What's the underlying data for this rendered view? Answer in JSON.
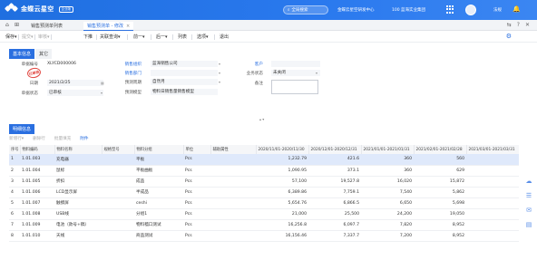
{
  "app": {
    "logo_text": "金蝶云星空",
    "logo_badge": "企业版",
    "search_label": "全局搜索",
    "org": "100 蓝海实业集团",
    "center": "金蝶云星空研发中心",
    "user": "法规"
  },
  "tabbar": {
    "tabs": [
      {
        "label": "销售预测单列表"
      },
      {
        "label": "销售预测单 - 修改"
      }
    ],
    "close_glyph": "×"
  },
  "toolbar": {
    "items": [
      {
        "label": "保存",
        "caret": "▾",
        "enabled": true
      },
      {
        "label": "提交",
        "caret": "▾",
        "enabled": false
      },
      {
        "label": "审核",
        "caret": "▾",
        "enabled": false
      },
      {
        "label": "下推",
        "caret": "",
        "enabled": true
      },
      {
        "label": "关联查询",
        "caret": "▾",
        "enabled": true
      },
      {
        "label": "前一",
        "caret": "▾",
        "enabled": true
      },
      {
        "label": "后一",
        "caret": "▾",
        "enabled": true
      },
      {
        "label": "列表",
        "caret": "",
        "enabled": true
      },
      {
        "label": "选项",
        "caret": "▾",
        "enabled": true
      },
      {
        "label": "退出",
        "caret": "",
        "enabled": true
      }
    ]
  },
  "section_tabs": [
    "基本信息",
    "其它"
  ],
  "form": {
    "bill_no_label": "单据编号",
    "bill_no": "XLYCD000006",
    "date_label": "日期",
    "date": "2021/2/25",
    "doc_status_label": "单据状态",
    "doc_status": "已审核",
    "stamp": "已审核",
    "sales_org_label": "销售组织",
    "sales_org": "蓝海销售公司",
    "sales_dept_label": "销售部门",
    "forecast_type_label": "预测周期",
    "forecast_type": "自然月",
    "forecast_model_label": "预测模型",
    "forecast_model": "物料日销售量销售模型",
    "customer_label": "客户",
    "biz_status_label": "业务状态",
    "biz_status": "未关闭",
    "memo_label": "备注"
  },
  "detail": {
    "tab": "明细信息",
    "toolbar": [
      {
        "label": "新增行",
        "caret": "▾",
        "active": false
      },
      {
        "label": "删除行",
        "caret": "",
        "active": false
      },
      {
        "label": "批量填充",
        "caret": "",
        "active": false
      },
      {
        "label": "附件",
        "caret": "",
        "active": true
      }
    ],
    "columns": [
      "序号",
      "物料编码",
      "物料名称",
      "规格型号",
      "物料分组",
      "单位",
      "辅助属性",
      "2020/11/01-2020/11/30",
      "2020/12/01-2020/12/31",
      "2021/01/01-2021/01/31",
      "2021/02/01-2021/02/28",
      "2021/03/01-2021/03/31"
    ],
    "rows": [
      {
        "seq": "1",
        "code": "1.01.003",
        "name": "充电器",
        "spec": "",
        "group": "平板",
        "unit": "Pcs",
        "aux": "",
        "v1": "1,232.79",
        "v2": "421.6",
        "v3": "360",
        "v4": "560",
        "v5": ""
      },
      {
        "seq": "2",
        "code": "1.01.004",
        "name": "鼠标",
        "spec": "",
        "group": "平板曲板",
        "unit": "Pcs",
        "aux": "",
        "v1": "1,090.95",
        "v2": "373.1",
        "v3": "360",
        "v4": "629",
        "v5": ""
      },
      {
        "seq": "3",
        "code": "1.01.005",
        "name": "折扣",
        "spec": "",
        "group": "成品",
        "unit": "Pcs",
        "aux": "",
        "v1": "57,100",
        "v2": "19,527.8",
        "v3": "16,020",
        "v4": "15,872",
        "v5": ""
      },
      {
        "seq": "4",
        "code": "1.01.006",
        "name": "LCD显示屏",
        "spec": "",
        "group": "半成品",
        "unit": "Pcs",
        "aux": "",
        "v1": "6,389.86",
        "v2": "7,759.1",
        "v3": "7,540",
        "v4": "5,862",
        "v5": ""
      },
      {
        "seq": "5",
        "code": "1.01.007",
        "name": "触摸屏",
        "spec": "",
        "group": "ceshi",
        "unit": "Pcs",
        "aux": "",
        "v1": "5,654.76",
        "v2": "6,866.5",
        "v3": "6,650",
        "v4": "5,698",
        "v5": ""
      },
      {
        "seq": "6",
        "code": "1.01.008",
        "name": "USB线",
        "spec": "",
        "group": "分组1",
        "unit": "Pcs",
        "aux": "",
        "v1": "21,000",
        "v2": "25,500",
        "v3": "24,200",
        "v4": "19,050",
        "v5": ""
      },
      {
        "seq": "7",
        "code": "1.01.009",
        "name": "电池（款号+稿）",
        "spec": "",
        "group": "物料稽口测试",
        "unit": "Pcs",
        "aux": "",
        "v1": "16,256.8",
        "v2": "6,097.7",
        "v3": "7,820",
        "v4": "8,952",
        "v5": ""
      },
      {
        "seq": "8",
        "code": "1.01.010",
        "name": "天线",
        "spec": "",
        "group": "商品测试",
        "unit": "Pcs",
        "aux": "",
        "v1": "16,156.46",
        "v2": "7,337.7",
        "v3": "7,200",
        "v4": "8,952",
        "v5": ""
      }
    ]
  },
  "colors": {
    "accent": "#2a6fe0",
    "selected_row": "#dfe9fb"
  }
}
